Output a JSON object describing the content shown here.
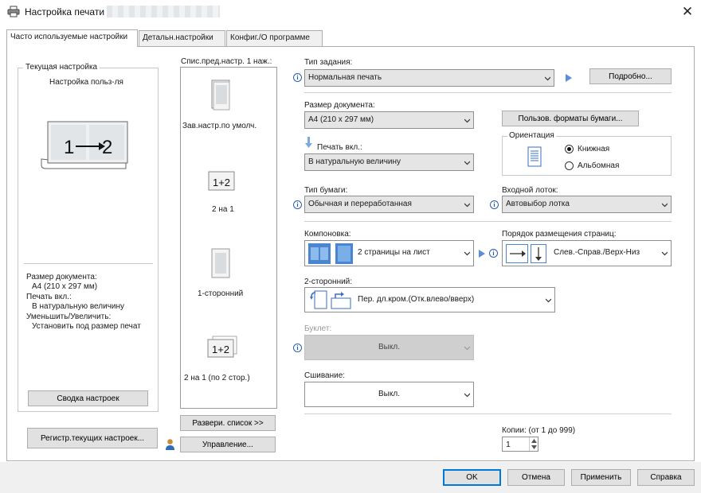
{
  "window": {
    "title": "Настройка печати"
  },
  "tabs": [
    {
      "label": "Часто используемые настройки"
    },
    {
      "label": "Детальн.настройки"
    },
    {
      "label": "Конфиг./О программе"
    }
  ],
  "current": {
    "legend": "Текущая настройка",
    "name": "Настройка польз-ля",
    "summary": [
      "Размер документа:",
      "A4 (210 x 297 мм)",
      "Печать вкл.:",
      "В натуральную величину",
      "Уменьшить/Увеличить:",
      "Установить под размер печат"
    ],
    "summary_button": "Сводка настроек",
    "register_button": "Регистр.текущих настроек..."
  },
  "favorites": {
    "label": "Спис.пред.настр. 1 наж.:",
    "items": [
      {
        "caption": "Зав.настр.по умолч."
      },
      {
        "caption": "2 на 1",
        "badge": "1+2"
      },
      {
        "caption": "1-сторонний"
      },
      {
        "caption": "2 на 1 (по 2 стор.)",
        "badge": "1+2"
      }
    ],
    "expand_button": "Развери. список >>",
    "manage_button": "Управление..."
  },
  "job_type": {
    "label": "Тип задания:",
    "value": "Нормальная печать",
    "details_button": "Подробно..."
  },
  "doc_size": {
    "label": "Размер документа:",
    "value": "A4 (210 x 297 мм)",
    "custom_button": "Пользов. форматы бумаги..."
  },
  "print_on": {
    "label": "Печать вкл.:",
    "value": "В натуральную величину"
  },
  "orientation": {
    "legend": "Ориентация",
    "portrait": "Книжная",
    "landscape": "Альбомная",
    "selected": "portrait"
  },
  "paper_type": {
    "label": "Тип бумаги:",
    "value": "Обычная и переработанная"
  },
  "input_tray": {
    "label": "Входной лоток:",
    "value": "Автовыбор лотка"
  },
  "layout": {
    "label": "Компоновка:",
    "value": "2 страницы на лист"
  },
  "page_order": {
    "label": "Порядок размещения страниц:",
    "value": "Слев.-Справ./Верх-Низ"
  },
  "duplex": {
    "label": "2-сторонний:",
    "value": "Пер. дл.кром.(Отк.влево/вверх)"
  },
  "booklet": {
    "label": "Буклет:",
    "value": "Выкл."
  },
  "stapling": {
    "label": "Сшивание:",
    "value": "Выкл."
  },
  "copies": {
    "label": "Копии: (от 1 до 999)",
    "value": "1"
  },
  "footer": {
    "ok": "OK",
    "cancel": "Отмена",
    "apply": "Применить",
    "help": "Справка"
  },
  "colors": {
    "accent": "#0078d7",
    "info": "#2a5ea8",
    "play": "#5b8ed6"
  }
}
